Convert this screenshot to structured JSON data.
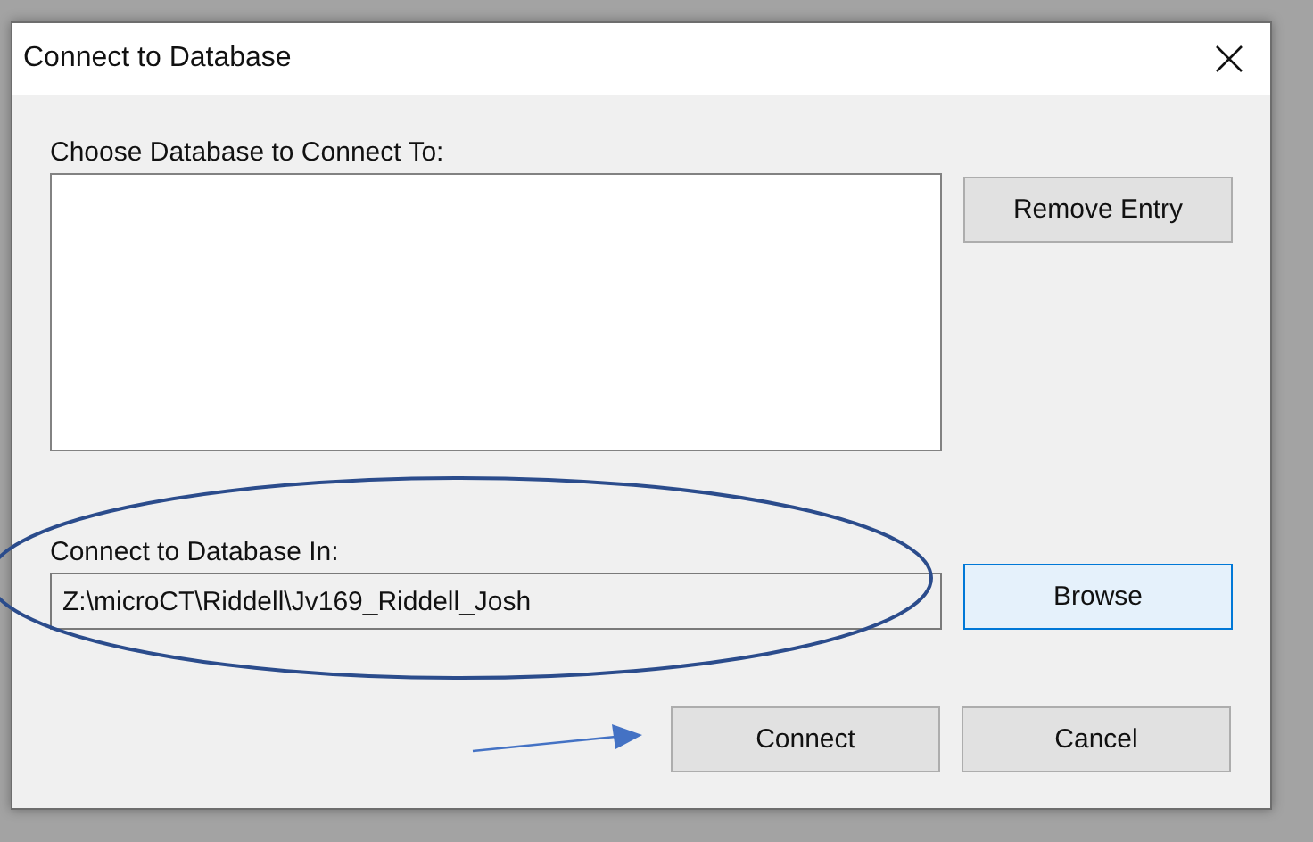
{
  "window": {
    "title": "Connect to Database"
  },
  "database_list": {
    "label": "Choose Database to Connect To:"
  },
  "remove_button": {
    "label": "Remove Entry",
    "focused": false
  },
  "location": {
    "label": "Connect to Database In:",
    "value": "Z:\\microCT\\Riddell\\Jv169_Riddell_Josh"
  },
  "browse_button": {
    "label": "Browse",
    "focused": true
  },
  "buttons": [
    {
      "label": "Connect",
      "focused": false
    },
    {
      "label": "Cancel",
      "focused": false
    }
  ]
}
